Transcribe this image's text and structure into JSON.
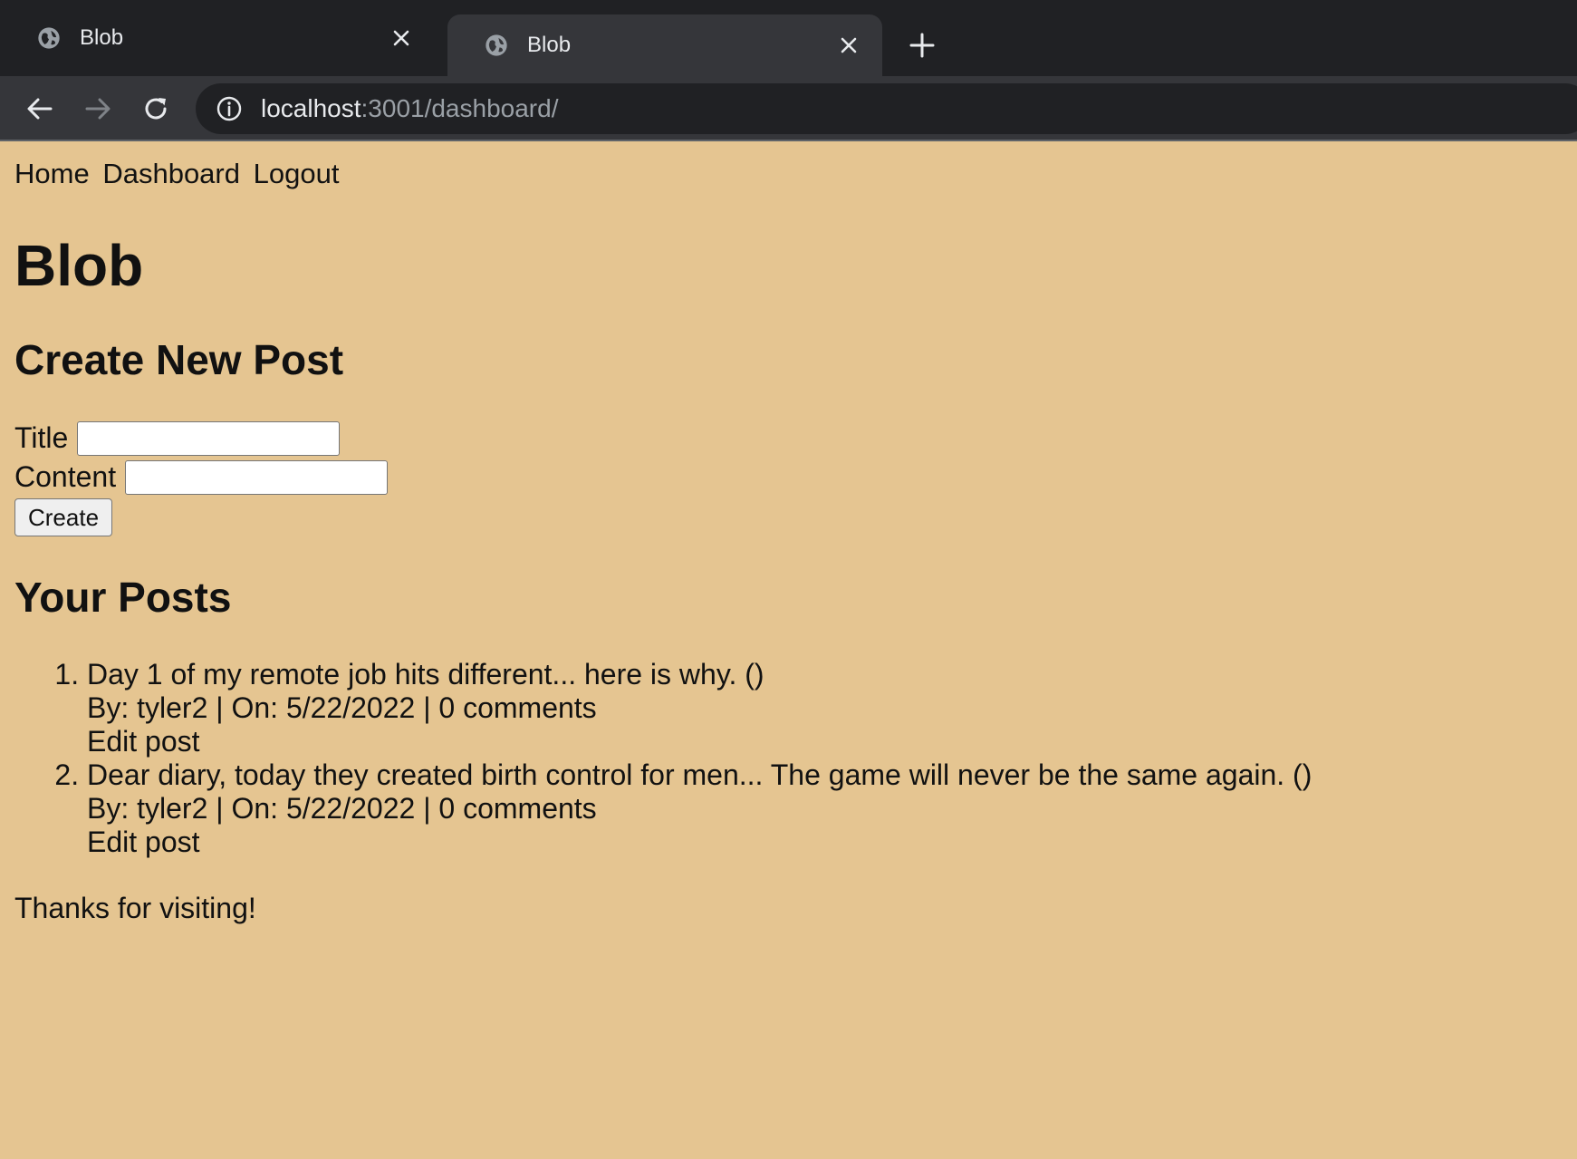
{
  "browser": {
    "tabs": [
      {
        "title": "Blob",
        "active": false
      },
      {
        "title": "Blob",
        "active": true
      }
    ],
    "url_host": "localhost",
    "url_rest": ":3001/dashboard/"
  },
  "nav": {
    "home": "Home",
    "dashboard": "Dashboard",
    "logout": "Logout"
  },
  "site_title": "Blob",
  "create": {
    "heading": "Create New Post",
    "title_label": "Title",
    "title_value": "",
    "content_label": "Content",
    "content_value": "",
    "button": "Create"
  },
  "posts": {
    "heading": "Your Posts",
    "items": [
      {
        "title": "Day 1 of my remote job hits different... here is why. ()",
        "meta": "By: tyler2 | On: 5/22/2022 | 0 comments",
        "edit": "Edit post"
      },
      {
        "title": "Dear diary, today they created birth control for men... The game will never be the same again. ()",
        "meta": "By: tyler2 | On: 5/22/2022 | 0 comments",
        "edit": "Edit post"
      }
    ]
  },
  "footer": "Thanks for visiting!",
  "colors": {
    "page_background": "#e5c591",
    "chrome_dark": "#202124",
    "chrome_toolbar": "#35363a"
  },
  "icons": [
    "globe-icon",
    "close-icon",
    "plus-icon",
    "back-arrow-icon",
    "forward-arrow-icon",
    "reload-icon",
    "info-icon"
  ]
}
